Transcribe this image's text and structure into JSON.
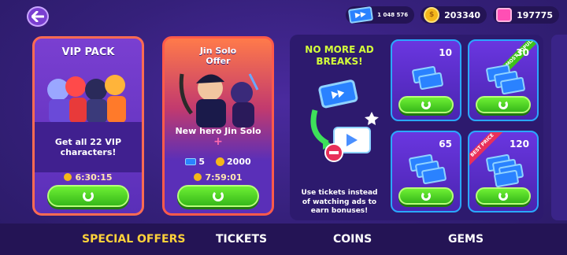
{
  "resources": {
    "tickets": "1 048 576",
    "coins": "203340",
    "gems": "197775"
  },
  "offers": {
    "vip": {
      "title": "VIP PACK",
      "description": "Get all 22 VIP characters!",
      "timer": "6:30:15"
    },
    "jin": {
      "title": "Jin Solo Offer",
      "description": "New hero Jin Solo",
      "plus": "+",
      "tickets": "5",
      "coins": "2000",
      "timer": "7:59:01"
    }
  },
  "tickets_panel": {
    "headline": "NO MORE AD BREAKS!",
    "footer": "Use tickets instead of watching ads to earn bonuses!",
    "packs": [
      {
        "amount": "10",
        "ribbon": ""
      },
      {
        "amount": "30",
        "ribbon": "MOST POPULAR"
      },
      {
        "amount": "65",
        "ribbon": ""
      },
      {
        "amount": "120",
        "ribbon": "BEST PRICE"
      }
    ]
  },
  "tabs": [
    "SPECIAL OFFERS",
    "TICKETS",
    "COINS",
    "GEMS"
  ],
  "colors": {
    "background": "#35207a",
    "active_tab": "#ffd23a",
    "accent_border": "#ff6b52",
    "button_green": "#4fd82a"
  }
}
